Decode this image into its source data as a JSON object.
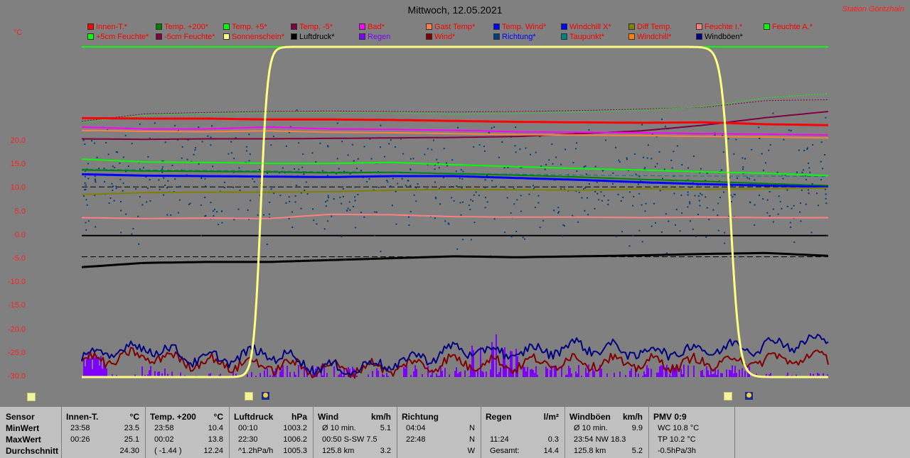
{
  "title": "Mittwoch, 12.05.2021",
  "station": "Station Göritzhain",
  "unit": "°C",
  "legend": [
    {
      "label": "Innen-T.*",
      "color": "#ff0000"
    },
    {
      "label": "Temp. +200*",
      "color": "#008000"
    },
    {
      "label": "Temp. +5*",
      "color": "#00ff00"
    },
    {
      "label": "Temp. -5*",
      "color": "#800040"
    },
    {
      "label": "Bad*",
      "color": "#ff00ff"
    },
    {
      "label": "Gast Temp*",
      "color": "#ff8040"
    },
    {
      "label": "Temp. Wind*",
      "color": "#0000ff"
    },
    {
      "label": "Windchill X*",
      "color": "#0000ff"
    },
    {
      "label": "Diff Temp.",
      "color": "#808000"
    },
    {
      "label": "Feuchte I.*",
      "color": "#ff8080"
    },
    {
      "label": "Feuchte A.*",
      "color": "#00ff00"
    },
    {
      "label": "+5cm Feuchte*",
      "color": "#00ff00"
    },
    {
      "label": "-5cm Feuchte*",
      "color": "#800040"
    },
    {
      "label": "Sonnenschein*",
      "color": "#ffff80"
    },
    {
      "label": "Luftdruck*",
      "color": "#000000"
    },
    {
      "label": "Regen",
      "color": "#8000ff"
    },
    {
      "label": "Wind*",
      "color": "#800000"
    },
    {
      "label": "Richtung*",
      "color": "#004080"
    },
    {
      "label": "Taupunkt*",
      "color": "#008080"
    },
    {
      "label": "Windchill*",
      "color": "#ff8000"
    },
    {
      "label": "Windböen*",
      "color": "#000080"
    }
  ],
  "legend_text_colors": [
    "#ff0000",
    "#ff0000",
    "#ff0000",
    "#ff0000",
    "#ff0000",
    "#ff0000",
    "#ff0000",
    "#ff0000",
    "#ff0000",
    "#ff0000",
    "#ff0000",
    "#ff0000",
    "#ff0000",
    "#ff0000",
    "#000000",
    "#8000ff",
    "#ff0000",
    "#0000ff",
    "#ff0000",
    "#ff0000",
    "#000000"
  ],
  "chart_data": {
    "type": "line",
    "title": "Mittwoch, 12.05.2021",
    "ylabel": "°C",
    "ylim": [
      -30,
      40
    ],
    "yticks": [
      -30,
      -25,
      -20,
      -15,
      -10,
      -5,
      0,
      5,
      10,
      15,
      20
    ],
    "ytick_labels": [
      "-30.0",
      "-25.0",
      "-20.0",
      "-15.0",
      "-10.0",
      "-5.0",
      "0.0",
      "5.0",
      "10.0",
      "15.0",
      "20.0"
    ],
    "x": [
      0,
      2,
      4,
      6,
      8,
      10,
      12,
      14,
      16,
      18,
      20,
      22,
      24
    ],
    "xlim": [
      0,
      24
    ],
    "series": [
      {
        "name": "Feuchte A.*",
        "style": "solid",
        "width": 2,
        "color": "#00ff00",
        "values": [
          40,
          40,
          40,
          40,
          40,
          40,
          40,
          40,
          40,
          40,
          40,
          40,
          40
        ]
      },
      {
        "name": "-5cm Feuchte*",
        "style": "dotted",
        "width": 1,
        "color": "#800040",
        "values": [
          24.2,
          25.8,
          26.1,
          26.3,
          26.4,
          26.3,
          26.2,
          26.3,
          26.5,
          26.8,
          27.2,
          28.6,
          28.8
        ]
      },
      {
        "name": "+5cm Feuchte*",
        "style": "dotted",
        "width": 1,
        "color": "#00ff00",
        "values": [
          24.0,
          25.5,
          25.8,
          26.0,
          26.1,
          26.0,
          25.8,
          25.9,
          26.2,
          26.6,
          27.3,
          29.2,
          30.1
        ]
      },
      {
        "name": "Temp. -5*",
        "style": "solid",
        "width": 2,
        "color": "#800040",
        "values": [
          20.5,
          20.4,
          20.5,
          20.5,
          20.6,
          20.7,
          20.8,
          21.0,
          21.6,
          22.2,
          23.4,
          25.0,
          26.3
        ]
      },
      {
        "name": "Innen-T.*",
        "style": "solid",
        "width": 3,
        "color": "#ff0000",
        "values": [
          24.9,
          24.8,
          24.8,
          24.6,
          24.6,
          24.5,
          24.3,
          24.1,
          24.0,
          23.9,
          24.0,
          23.6,
          23.4
        ]
      },
      {
        "name": "Bad*",
        "style": "solid",
        "width": 2,
        "color": "#ff00ff",
        "values": [
          23.0,
          22.6,
          22.6,
          23.0,
          22.6,
          22.5,
          22.3,
          22.0,
          21.9,
          21.8,
          21.6,
          21.5,
          21.3
        ]
      },
      {
        "name": "Gast Temp*",
        "style": "solid",
        "width": 2,
        "color": "#ff8040",
        "values": [
          22.3,
          22.1,
          22.0,
          22.2,
          21.9,
          21.8,
          21.6,
          21.4,
          21.3,
          21.2,
          21.0,
          20.9,
          20.7
        ]
      },
      {
        "name": "Temp. +5*",
        "style": "solid",
        "width": 2,
        "color": "#00ff00",
        "values": [
          16.2,
          15.6,
          15.5,
          15.3,
          15.3,
          15.5,
          15.0,
          14.6,
          14.2,
          13.9,
          13.5,
          13.2,
          12.7
        ]
      },
      {
        "name": "Temp. +200*",
        "style": "solid",
        "width": 2,
        "color": "#008000",
        "values": [
          13.9,
          13.7,
          13.6,
          13.5,
          13.3,
          13.4,
          13.1,
          12.8,
          12.4,
          11.9,
          11.5,
          11.0,
          10.6
        ]
      },
      {
        "name": "Taupunkt*",
        "style": "dashed",
        "width": 1,
        "color": "#008080",
        "values": [
          14.1,
          13.9,
          13.8,
          13.7,
          13.5,
          13.5,
          13.2,
          13.0,
          12.8,
          12.7,
          12.6,
          12.6,
          12.5
        ]
      },
      {
        "name": "Temp. Wind*",
        "style": "solid",
        "width": 3,
        "color": "#0000ff",
        "values": [
          13.0,
          12.7,
          12.6,
          12.5,
          12.4,
          12.6,
          12.6,
          12.2,
          11.8,
          11.3,
          10.9,
          10.6,
          10.3
        ]
      },
      {
        "name": "Diff Temp.",
        "style": "solid",
        "width": 2,
        "color": "#808000",
        "values": [
          8.7,
          9.1,
          9.2,
          9.2,
          9.3,
          9.6,
          9.8,
          9.7,
          9.6,
          9.9,
          9.8,
          9.9,
          10.1
        ]
      },
      {
        "name": "Feuchte I.*",
        "style": "solid",
        "width": 2,
        "color": "#ff8080",
        "values": [
          3.8,
          3.6,
          3.7,
          3.6,
          4.5,
          4.4,
          4.0,
          3.9,
          3.9,
          3.8,
          3.9,
          3.8,
          3.8
        ]
      },
      {
        "name": "Luftdruck*",
        "style": "solid",
        "width": 3,
        "color": "#000000",
        "values": [
          -6.7,
          -5.8,
          -5.6,
          -5.6,
          -5.2,
          -4.8,
          -4.4,
          -4.6,
          -4.4,
          -4.2,
          -3.9,
          -3.7,
          -4.3
        ]
      },
      {
        "name": "Wind*",
        "style": "solid",
        "width": 2,
        "color": "#800000",
        "values": [
          -26.8,
          -25.5,
          -27.0,
          -27.5,
          -28.2,
          -28.0,
          -26.8,
          -27.3,
          -26.6,
          -27.2,
          -27.0,
          -26.4,
          -25.8
        ]
      },
      {
        "name": "Windböen*",
        "style": "solid",
        "width": 2,
        "color": "#000080",
        "values": [
          -25.8,
          -23.5,
          -26.5,
          -24.8,
          -28.5,
          -27.2,
          -24.2,
          -25.0,
          -23.4,
          -24.8,
          -24.2,
          -23.2,
          -22.3
        ]
      }
    ],
    "sunshine": {
      "name": "Sonnenschein*",
      "color": "#ffff80",
      "rise_hour": 5.6,
      "set_hour": 20.9,
      "low": -30,
      "high": 40
    },
    "reference_lines": [
      {
        "value": 0,
        "color": "#000000",
        "style": "solid"
      },
      {
        "value": -4.5,
        "color": "#000000",
        "style": "dashed"
      },
      {
        "value": 10.3,
        "color": "#000000",
        "style": "dashed"
      }
    ],
    "rain": {
      "name": "Regen",
      "color": "#8000ff",
      "base": -30
    },
    "direction_scatter": {
      "name": "Richtung*",
      "color": "#004080"
    }
  },
  "table": {
    "row_labels": [
      "Sensor",
      "MinWert",
      "MaxWert",
      "Durchschnitt"
    ],
    "columns": [
      {
        "header": "Innen-T.",
        "unit": "°C",
        "rows": [
          [
            "23:58",
            "23.5"
          ],
          [
            "00:26",
            "25.1"
          ],
          [
            "",
            "24.30"
          ]
        ]
      },
      {
        "header": "Temp. +200",
        "unit": "°C",
        "rows": [
          [
            "23:58",
            "10.4"
          ],
          [
            "00:02",
            "13.8"
          ],
          [
            "( -1.44 )",
            "12.24"
          ]
        ]
      },
      {
        "header": "Luftdruck",
        "unit": "hPa",
        "rows": [
          [
            "00:10",
            "1003.2"
          ],
          [
            "22:30",
            "1006.2"
          ],
          [
            "^1.2hPa/h",
            "1005.3"
          ]
        ]
      },
      {
        "header": "Wind",
        "unit": "km/h",
        "rows": [
          [
            "Ø 10 min.",
            "5.1"
          ],
          [
            "00:50   S-SW 7.5",
            ""
          ],
          [
            "125.8 km",
            "3.2"
          ]
        ]
      },
      {
        "header": "Richtung",
        "unit": "",
        "rows": [
          [
            "04:04",
            "N"
          ],
          [
            "22:48",
            "N"
          ],
          [
            "",
            "W"
          ]
        ]
      },
      {
        "header": "Regen",
        "unit": "l/m²",
        "rows": [
          [
            "",
            ""
          ],
          [
            "11:24",
            "0.3"
          ],
          [
            "Gesamt:",
            "14.4"
          ]
        ]
      },
      {
        "header": "Windböen",
        "unit": "km/h",
        "rows": [
          [
            "Ø 10 min.",
            "9.9"
          ],
          [
            "23:54   NW 18.3",
            ""
          ],
          [
            "125.8 km",
            "5.2"
          ]
        ]
      },
      {
        "header": "PMV 0:9",
        "unit": "",
        "rows": [
          [
            "WC 10.8 °C",
            ""
          ],
          [
            "TP 10.2 °C",
            ""
          ],
          [
            "-0.5hPa/3h",
            ""
          ]
        ]
      }
    ]
  }
}
